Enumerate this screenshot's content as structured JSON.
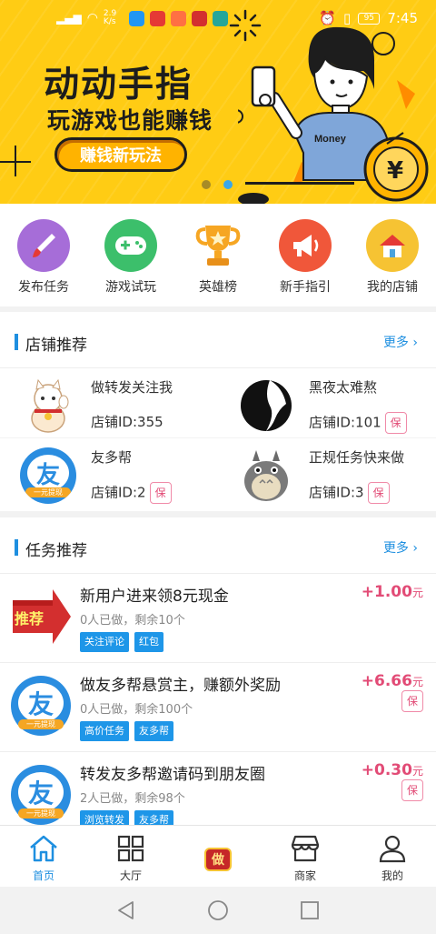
{
  "status": {
    "speed": "2.9 K/s",
    "battery": "95",
    "time": "7:45"
  },
  "banner": {
    "title": "动动手指",
    "subtitle": "玩游戏也能赚钱",
    "button": "赚钱新玩法",
    "shirt_text": "Money",
    "coin": "¥"
  },
  "categories": [
    {
      "label": "发布任务",
      "icon": "brush-icon",
      "color": "#a66dd8"
    },
    {
      "label": "游戏试玩",
      "icon": "gamepad-icon",
      "color": "#3cbf6b"
    },
    {
      "label": "英雄榜",
      "icon": "trophy-icon",
      "color": "#ffffff"
    },
    {
      "label": "新手指引",
      "icon": "megaphone-icon",
      "color": "#f0573a"
    },
    {
      "label": "我的店铺",
      "icon": "house-icon",
      "color": "#f6c333"
    }
  ],
  "stores": {
    "title": "店铺推荐",
    "more": "更多",
    "items": [
      {
        "name": "做转发关注我",
        "id_label": "店铺ID:355",
        "bao": ""
      },
      {
        "name": "黑夜太难熬",
        "id_label": "店铺ID:101",
        "bao": "保"
      },
      {
        "name": "友多帮",
        "id_label": "店铺ID:2",
        "bao": "保",
        "logo_text": "友",
        "logo_sub": "一元提现"
      },
      {
        "name": "正规任务快来做",
        "id_label": "店铺ID:3",
        "bao": "保"
      }
    ]
  },
  "tasks": {
    "title": "任务推荐",
    "more": "更多",
    "items": [
      {
        "title": "新用户进来领8元现金",
        "meta": "0人已做，剩余10个",
        "tags": [
          "关注评论",
          "红包"
        ],
        "price": "+1.00",
        "unit": "元",
        "bao": "",
        "thumb": "推荐"
      },
      {
        "title": "做友多帮悬赏主，赚额外奖励",
        "meta": "0人已做，剩余100个",
        "tags": [
          "高价任务",
          "友多帮"
        ],
        "price": "+6.66",
        "unit": "元",
        "bao": "保",
        "thumb": "友",
        "thumb_sub": "一元提现"
      },
      {
        "title": "转发友多帮邀请码到朋友圈",
        "meta": "2人已做，剩余98个",
        "tags": [
          "浏览转发",
          "友多帮"
        ],
        "price": "+0.30",
        "unit": "元",
        "bao": "保",
        "thumb": "友",
        "thumb_sub": "一元提现"
      }
    ]
  },
  "tabbar": [
    {
      "label": "首页",
      "icon": "home-icon",
      "active": true
    },
    {
      "label": "大厅",
      "icon": "grid-icon",
      "active": false
    },
    {
      "label": "",
      "icon": "badge-icon",
      "badge_text": "做",
      "active": false
    },
    {
      "label": "商家",
      "icon": "shop-icon",
      "active": false
    },
    {
      "label": "我的",
      "icon": "user-icon",
      "active": false
    }
  ],
  "colors": {
    "accent": "#1e8fe0",
    "price": "#e24b76",
    "banner": "#ffcc14"
  }
}
